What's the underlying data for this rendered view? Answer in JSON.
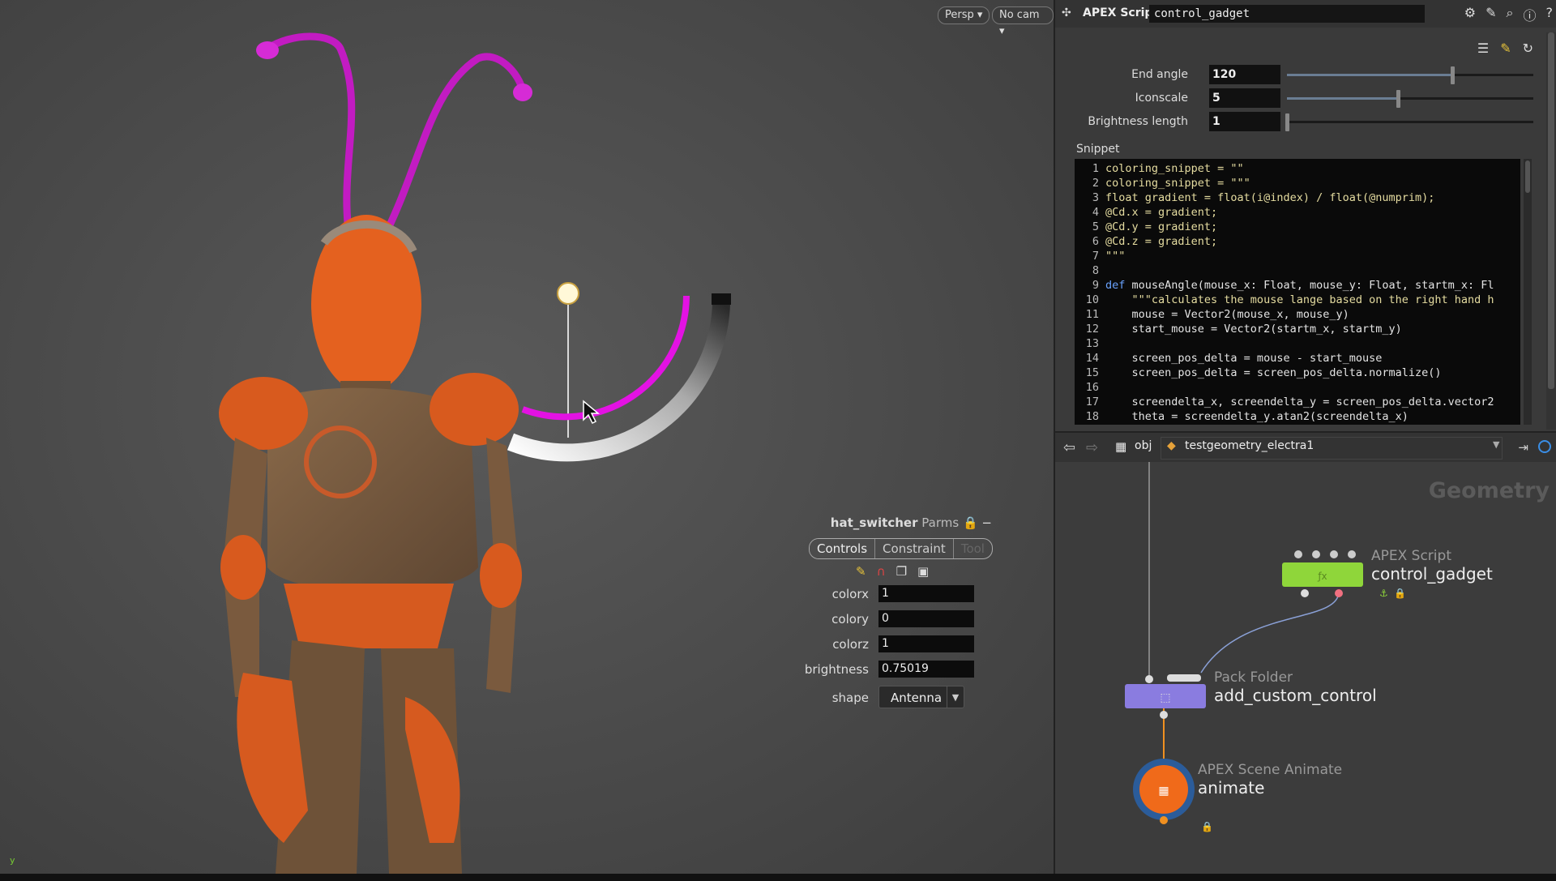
{
  "viewport": {
    "persp_label": "Persp",
    "cam_label": "No cam",
    "axis_label": "y"
  },
  "parms_panel": {
    "node_name": "hat_switcher",
    "title_suffix": "Parms",
    "tabs": [
      "Controls",
      "Constraint",
      "Tool"
    ],
    "params": [
      {
        "label": "colorx",
        "value": "1"
      },
      {
        "label": "colory",
        "value": "0"
      },
      {
        "label": "colorz",
        "value": "1"
      },
      {
        "label": "brightness",
        "value": "0.75019"
      }
    ],
    "shape": {
      "label": "shape",
      "value": "Antenna"
    }
  },
  "script_panel": {
    "type_label": "APEX Script",
    "node_name": "control_gadget",
    "sliders": [
      {
        "label": "End angle",
        "value": "120",
        "fraction": 0.67
      },
      {
        "label": "Iconscale",
        "value": "5",
        "fraction": 0.45
      },
      {
        "label": "Brightness length",
        "value": "1",
        "fraction": 0.0
      }
    ],
    "snippet_label": "Snippet",
    "code_lines": [
      {
        "n": "1",
        "t": "coloring_snippet = \"\"",
        "s": "str"
      },
      {
        "n": "2",
        "t": "coloring_snippet = \"\"\"",
        "s": "str"
      },
      {
        "n": "3",
        "t": "float gradient = float(i@index) / float(@numprim);",
        "s": "str"
      },
      {
        "n": "4",
        "t": "@Cd.x = gradient;",
        "s": "str"
      },
      {
        "n": "5",
        "t": "@Cd.y = gradient;",
        "s": "str"
      },
      {
        "n": "6",
        "t": "@Cd.z = gradient;",
        "s": "str"
      },
      {
        "n": "7",
        "t": "\"\"\"",
        "s": "str"
      },
      {
        "n": "8",
        "t": "",
        "s": ""
      },
      {
        "n": "9",
        "t": "def mouseAngle(mouse_x: Float, mouse_y: Float, startm_x: Fl",
        "s": "kw"
      },
      {
        "n": "10",
        "t": "    \"\"\"calculates the mouse lange based on the right hand h",
        "s": "str"
      },
      {
        "n": "11",
        "t": "    mouse = Vector2(mouse_x, mouse_y)",
        "s": ""
      },
      {
        "n": "12",
        "t": "    start_mouse = Vector2(startm_x, startm_y)",
        "s": ""
      },
      {
        "n": "13",
        "t": "",
        "s": ""
      },
      {
        "n": "14",
        "t": "    screen_pos_delta = mouse - start_mouse",
        "s": ""
      },
      {
        "n": "15",
        "t": "    screen_pos_delta = screen_pos_delta.normalize()",
        "s": ""
      },
      {
        "n": "16",
        "t": "",
        "s": ""
      },
      {
        "n": "17",
        "t": "    screendelta_x, screendelta_y = screen_pos_delta.vector2",
        "s": ""
      },
      {
        "n": "18",
        "t": "    theta = screendelta_y.atan2(screendelta_x)",
        "s": ""
      }
    ]
  },
  "network_bar": {
    "crumb_obj": "obj",
    "crumb_geo": "testgeometry_electra1"
  },
  "network": {
    "context_label": "Geometry",
    "nodes": [
      {
        "type": "APEX Script",
        "name": "control_gadget",
        "color": "#8fd63a"
      },
      {
        "type": "Pack Folder",
        "name": "add_custom_control",
        "color": "#8a7ce0"
      },
      {
        "type": "APEX Scene Animate",
        "name": "animate",
        "color": "#f06a1a"
      }
    ]
  }
}
